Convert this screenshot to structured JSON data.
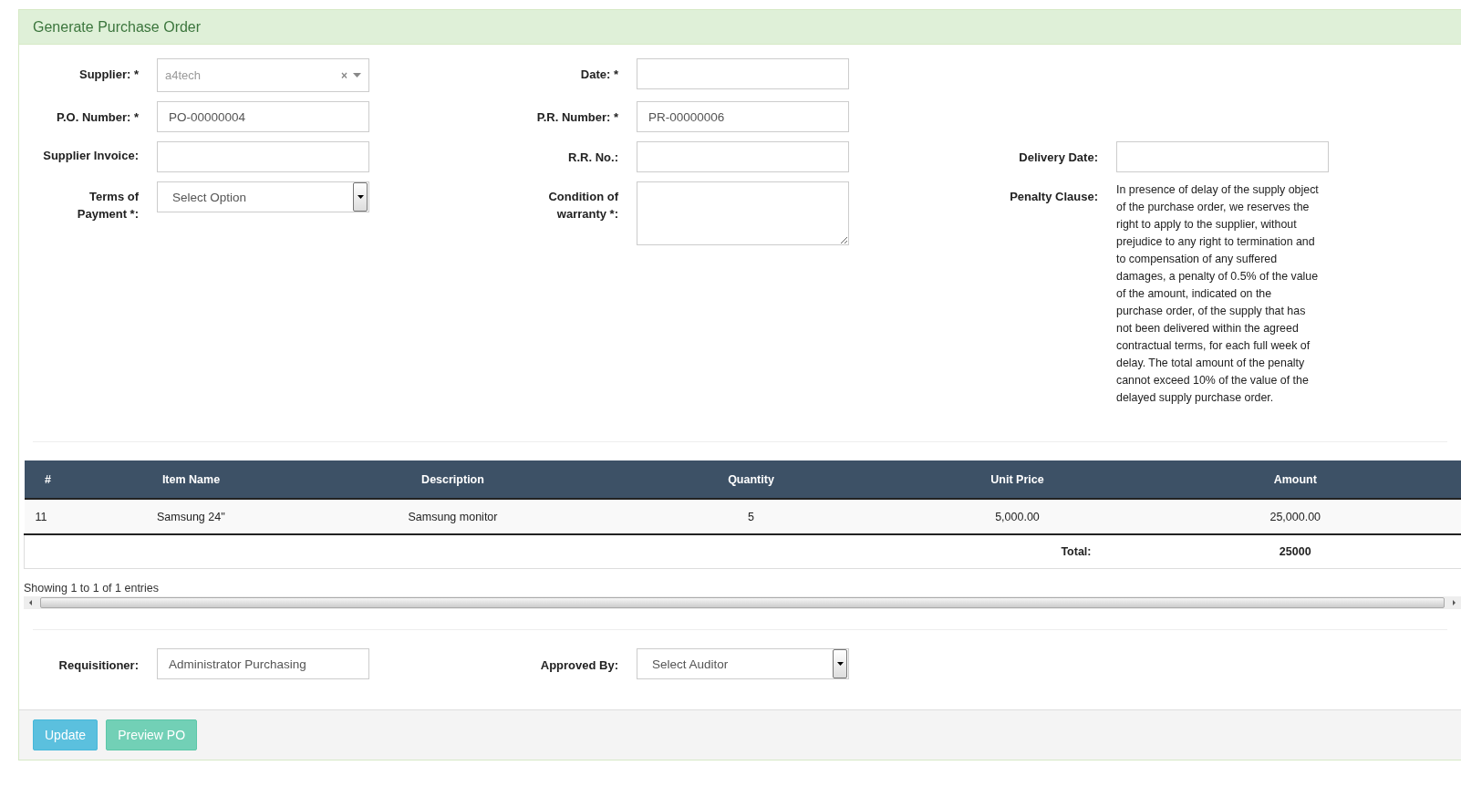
{
  "panel": {
    "title": "Generate Purchase Order"
  },
  "form_rows": [
    [
      {
        "kind": "combo",
        "label": "Supplier: *",
        "value": "a4tech",
        "clear": "×"
      },
      {
        "kind": "text",
        "label": "Date: *"
      },
      null
    ],
    [
      {
        "kind": "text",
        "label": "P.O. Number: *",
        "value": "PO-00000004"
      },
      {
        "kind": "text",
        "label": "P.R. Number: *",
        "value": "PR-00000006"
      },
      null
    ],
    [
      {
        "kind": "text",
        "label": "Supplier Invoice:"
      },
      {
        "kind": "text",
        "label": "R.R. No.:"
      },
      {
        "kind": "text",
        "label": "Delivery Date:"
      }
    ],
    [
      {
        "kind": "select",
        "label": "Terms of Payment *:",
        "value": "Select Option"
      },
      {
        "kind": "textarea",
        "label": "Condition of warranty *:"
      },
      {
        "kind": "note",
        "label": "Penalty Clause:",
        "value": "In presence of delay of the supply object of the purchase order, we reserves the right to apply to the supplier, without prejudice to any right to termination and to compensation of any suffered damages, a penalty of 0.5% of the value of the amount, indicated on the purchase order, of the supply that has not been delivered within the agreed contractual terms, for each full week of delay. The total amount of the penalty cannot exceed 10% of the value of the delayed supply purchase order."
      }
    ]
  ],
  "table": {
    "columns": [
      "#",
      "Item Name",
      "Description",
      "Quantity",
      "Unit Price",
      "Amount"
    ],
    "rows": [
      [
        "11",
        "Samsung 24''",
        "Samsung monitor",
        "5",
        "5,000.00",
        "25,000.00"
      ]
    ],
    "total_label": "Total:",
    "total_value": "25000"
  },
  "table_info": "Showing 1 to 1 of 1 entries",
  "footer_fields": [
    {
      "kind": "text",
      "label": "Requisitioner:",
      "value": "Administrator Purchasing"
    },
    {
      "kind": "select",
      "label": "Approved By:",
      "value": "Select Auditor"
    }
  ],
  "buttons": [
    {
      "label": "Update",
      "kind": "primary"
    },
    {
      "label": "Preview PO",
      "kind": "secondary"
    }
  ]
}
